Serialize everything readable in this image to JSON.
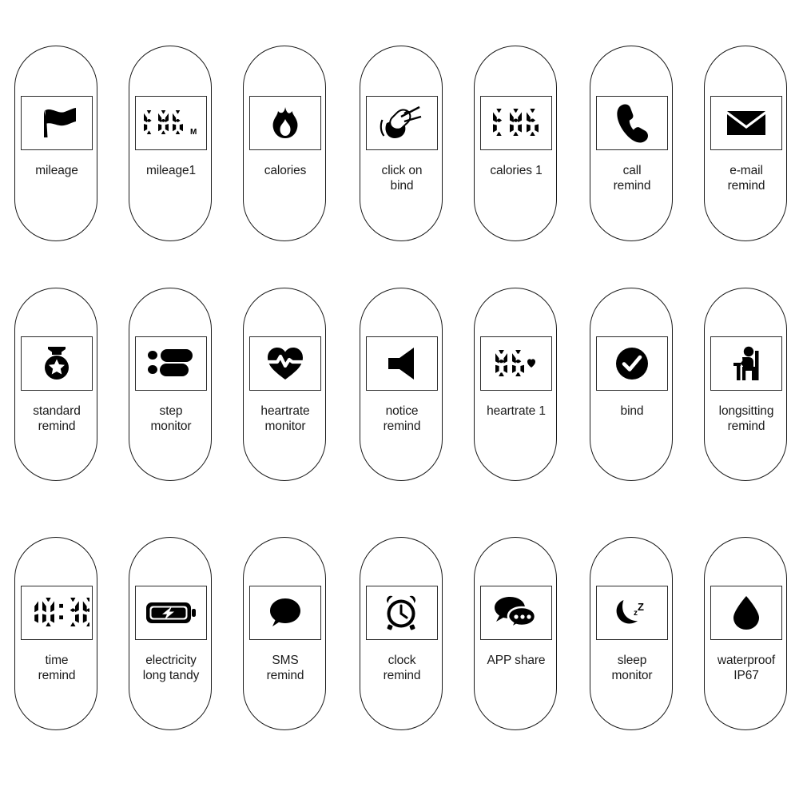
{
  "page": {
    "title": "Smart bracelet feature icon sheet",
    "background": "#ffffff",
    "stroke_color": "#1a1a1a",
    "icon_fill": "#000000",
    "columns": 7,
    "rows": 3
  },
  "items": [
    {
      "id": "mileage",
      "label": "mileage",
      "icon": "flag-icon",
      "row": 1,
      "col": 1
    },
    {
      "id": "mileage1",
      "label": "mileage1",
      "icon": "lcd-distance-icon",
      "row": 1,
      "col": 2,
      "display_value": "386",
      "display_unit": "M"
    },
    {
      "id": "calories",
      "label": "calories",
      "icon": "flame-icon",
      "row": 1,
      "col": 3
    },
    {
      "id": "click-on-bind",
      "label": "click on\nbind",
      "icon": "tap-hand-icon",
      "row": 1,
      "col": 4
    },
    {
      "id": "calories-1",
      "label": "calories 1",
      "icon": "lcd-calories-icon",
      "row": 1,
      "col": 5,
      "display_value": "386"
    },
    {
      "id": "call-remind",
      "label": "call\nremind",
      "icon": "phone-icon",
      "row": 1,
      "col": 6
    },
    {
      "id": "email-remind",
      "label": "e-mail\nremind",
      "icon": "envelope-icon",
      "row": 1,
      "col": 7
    },
    {
      "id": "standard-remind",
      "label": "standard\nremind",
      "icon": "medal-star-icon",
      "row": 2,
      "col": 1
    },
    {
      "id": "step-monitor",
      "label": "step\nmonitor",
      "icon": "footprints-icon",
      "row": 2,
      "col": 2
    },
    {
      "id": "heartrate-monitor",
      "label": "heartrate\nmonitor",
      "icon": "heart-pulse-icon",
      "row": 2,
      "col": 3
    },
    {
      "id": "notice-remind",
      "label": "notice\nremind",
      "icon": "speaker-icon",
      "row": 2,
      "col": 4
    },
    {
      "id": "heartrate-1",
      "label": "heartrate 1",
      "icon": "lcd-heartrate-icon",
      "row": 2,
      "col": 5,
      "display_value": "86"
    },
    {
      "id": "bind",
      "label": "bind",
      "icon": "check-circle-icon",
      "row": 2,
      "col": 6
    },
    {
      "id": "longsitting-remind",
      "label": "longsitting\nremind",
      "icon": "sitting-person-icon",
      "row": 2,
      "col": 7
    },
    {
      "id": "time-remind",
      "label": "time\nremind",
      "icon": "lcd-clock-icon",
      "row": 3,
      "col": 1,
      "display_value": "10:36"
    },
    {
      "id": "electricity",
      "label": "electricity\nlong tandy",
      "icon": "battery-charge-icon",
      "row": 3,
      "col": 2
    },
    {
      "id": "sms-remind",
      "label": "SMS\nremind",
      "icon": "chat-bubble-icon",
      "row": 3,
      "col": 3
    },
    {
      "id": "clock-remind",
      "label": "clock\nremind",
      "icon": "alarm-clock-icon",
      "row": 3,
      "col": 4
    },
    {
      "id": "app-share",
      "label": "APP share",
      "icon": "chat-bubbles-share-icon",
      "row": 3,
      "col": 5
    },
    {
      "id": "sleep-monitor",
      "label": "sleep\nmonitor",
      "icon": "moon-zzz-icon",
      "row": 3,
      "col": 6
    },
    {
      "id": "waterproof",
      "label": "waterproof\nIP67",
      "icon": "water-drop-icon",
      "row": 3,
      "col": 7
    }
  ]
}
